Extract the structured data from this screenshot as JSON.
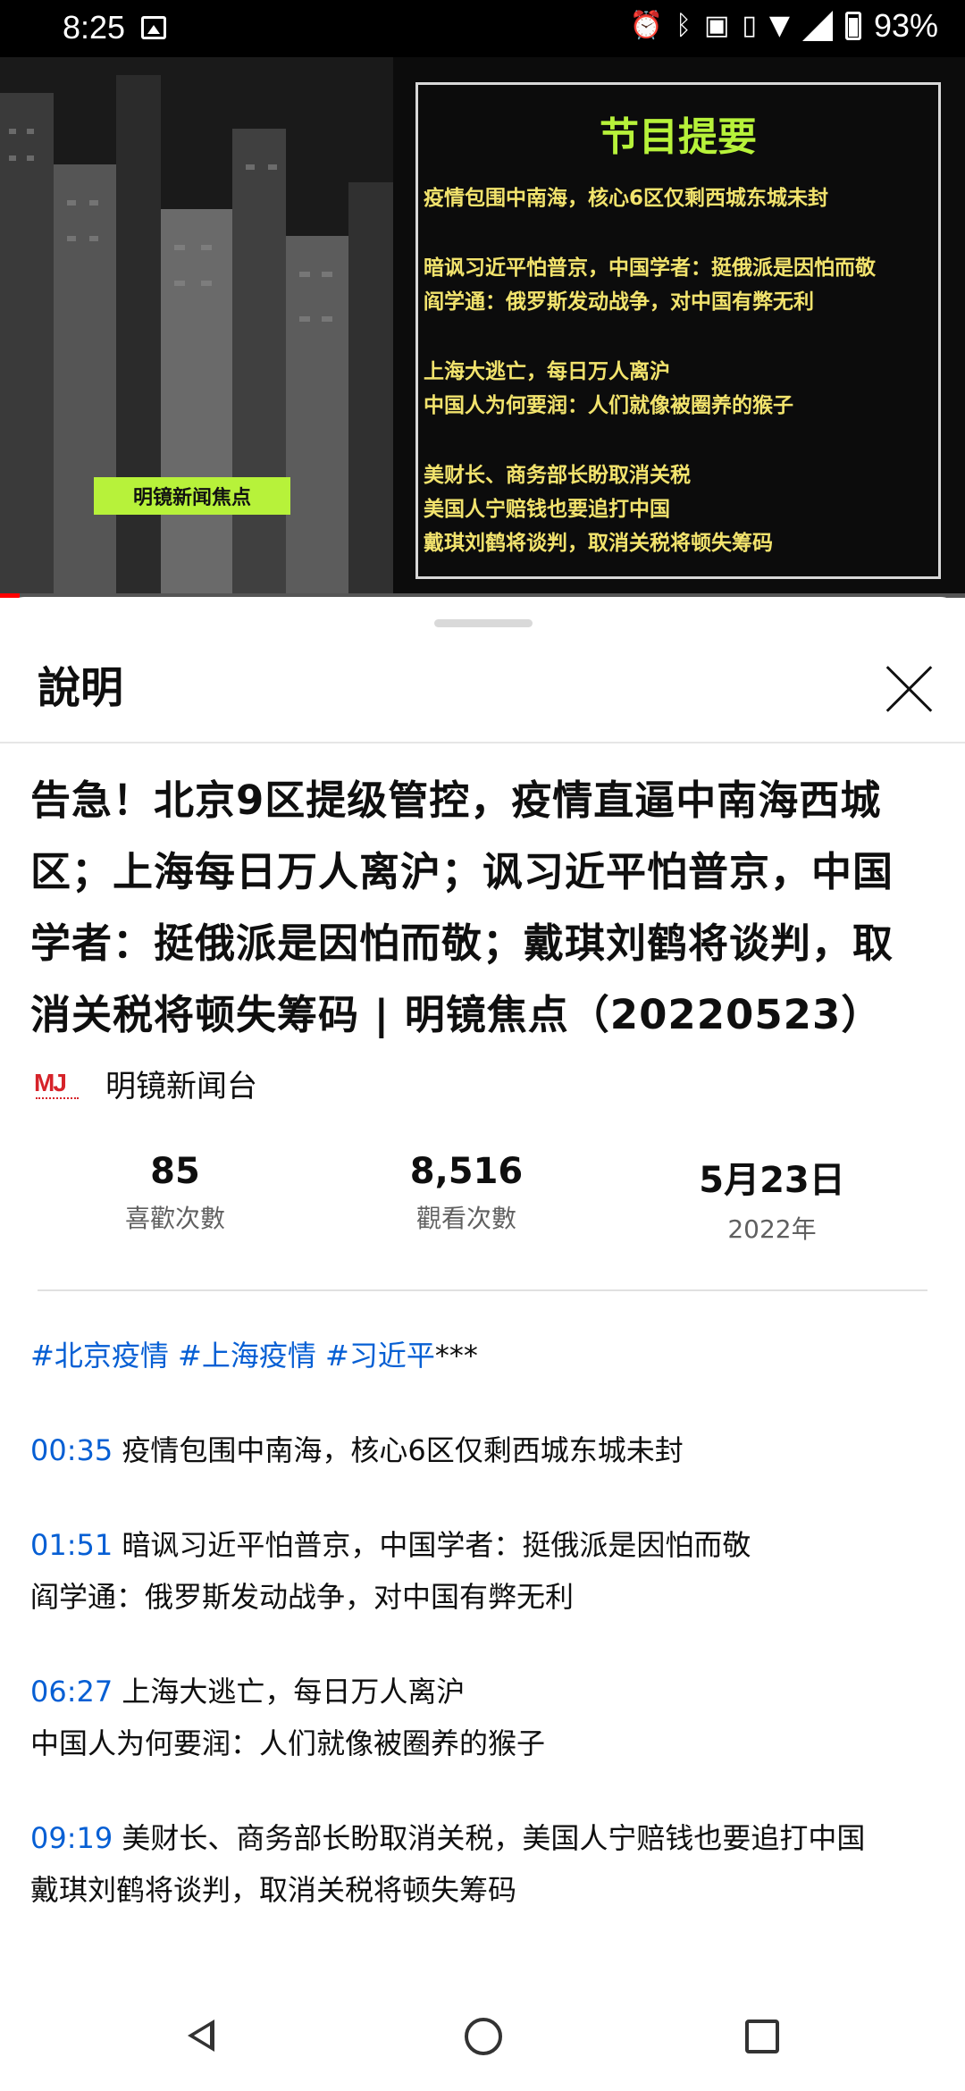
{
  "status_bar": {
    "time": "8:25",
    "battery": "93%"
  },
  "video": {
    "badge": "明镜新闻焦点",
    "box_title": "节目提要",
    "box_lines": [
      [
        "疫情包围中南海，核心6区仅剩西城东城未封"
      ],
      [
        "暗讽习近平怕普京，中国学者：挺俄派是因怕而敬",
        "阎学通：俄罗斯发动战争，对中国有弊无利"
      ],
      [
        "上海大逃亡，每日万人离沪",
        "中国人为何要润：人们就像被圈养的猴子"
      ],
      [
        "美财长、商务部长盼取消关税",
        "美国人宁赔钱也要追打中国",
        "戴琪刘鹤将谈判，取消关税将顿失筹码"
      ]
    ],
    "progress": 0.02
  },
  "sheet": {
    "title": "說明",
    "video_title": "告急！北京9区提级管控，疫情直逼中南海西城区；上海每日万人离沪；讽习近平怕普京，中国学者：挺俄派是因怕而敬；戴琪刘鹤将谈判，取消关税将顿失筹码 | 明镜焦点（20220523）",
    "channel": {
      "logo_text": "MJ",
      "name": "明镜新闻台"
    },
    "stats": {
      "likes_value": "85",
      "likes_label": "喜歡次數",
      "views_value": "8,516",
      "views_label": "觀看次數",
      "date_value": "5月23日",
      "date_year": "2022年"
    },
    "description": {
      "hashtags": [
        "#北京疫情",
        "#上海疫情",
        "#习近平"
      ],
      "hashtag_suffix": "***",
      "chapters": [
        {
          "time": "00:35",
          "text": "疫情包围中南海，核心6区仅剩西城东城未封",
          "more": []
        },
        {
          "time": "01:51",
          "text": "暗讽习近平怕普京，中国学者：挺俄派是因怕而敬",
          "more": [
            "阎学通：俄罗斯发动战争，对中国有弊无利"
          ]
        },
        {
          "time": "06:27",
          "text": "上海大逃亡，每日万人离沪",
          "more": [
            "中国人为何要润：人们就像被圈养的猴子"
          ]
        },
        {
          "time": "09:19",
          "text": "美财长、商务部长盼取消关税，美国人宁赔钱也要追打中国",
          "more": [
            "戴琪刘鹤将谈判，取消关税将顿失筹码"
          ]
        }
      ]
    }
  },
  "colors": {
    "link": "#065fd4",
    "accent_green": "#b7f23a",
    "box_text": "#f2e36d",
    "progress_red": "#ff0000"
  },
  "icons": {
    "status": [
      "image-icon",
      "alarm-icon",
      "bluetooth-icon",
      "nfc-icon",
      "vibrate-icon",
      "wifi-icon",
      "signal-icon",
      "battery-icon"
    ],
    "nav": [
      "back-icon",
      "home-icon",
      "recents-icon"
    ]
  }
}
